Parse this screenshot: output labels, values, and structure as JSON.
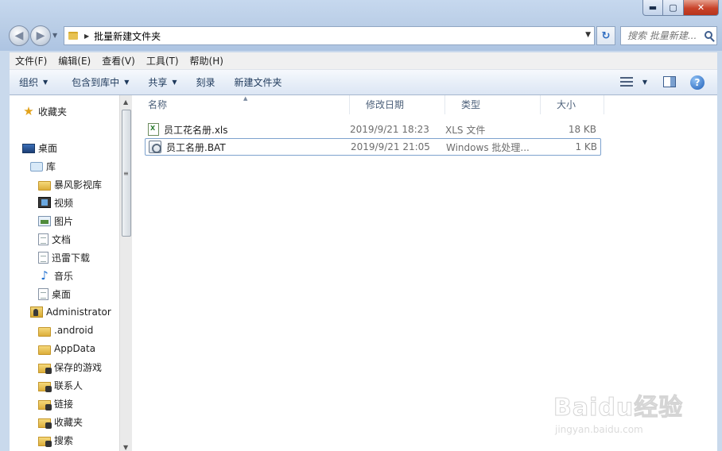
{
  "window": {
    "minimize_glyph": "▬",
    "maximize_glyph": "▢",
    "close_glyph": "✕"
  },
  "address_bar": {
    "path": "批量新建文件夹"
  },
  "search": {
    "placeholder": "搜索 批量新建..."
  },
  "menu": {
    "items": [
      "文件(F)",
      "编辑(E)",
      "查看(V)",
      "工具(T)",
      "帮助(H)"
    ]
  },
  "toolbar": {
    "organize": "组织",
    "include_in_library": "包含到库中",
    "share": "共享",
    "burn": "刻录",
    "new_folder": "新建文件夹"
  },
  "nav_pane": {
    "items": [
      {
        "label": "收藏夹",
        "icon": "star-icon"
      },
      {
        "label": "桌面",
        "icon": "desktop-icon"
      },
      {
        "label": "库",
        "icon": "library-icon"
      },
      {
        "label": "暴风影视库",
        "icon": "folder-icon"
      },
      {
        "label": "视频",
        "icon": "video-icon"
      },
      {
        "label": "图片",
        "icon": "picture-icon"
      },
      {
        "label": "文档",
        "icon": "document-icon"
      },
      {
        "label": "迅雷下载",
        "icon": "document-icon"
      },
      {
        "label": "音乐",
        "icon": "music-icon"
      },
      {
        "label": "桌面",
        "icon": "document-icon"
      },
      {
        "label": "Administrator",
        "icon": "user-folder-icon"
      },
      {
        "label": ".android",
        "icon": "folder-icon"
      },
      {
        "label": "AppData",
        "icon": "folder-icon"
      },
      {
        "label": "保存的游戏",
        "icon": "special-folder-icon"
      },
      {
        "label": "联系人",
        "icon": "special-folder-icon"
      },
      {
        "label": "链接",
        "icon": "special-folder-icon"
      },
      {
        "label": "收藏夹",
        "icon": "special-folder-icon"
      },
      {
        "label": "搜索",
        "icon": "special-folder-icon"
      }
    ]
  },
  "columns": {
    "name": "名称",
    "date": "修改日期",
    "type": "类型",
    "size": "大小"
  },
  "files": [
    {
      "name": "员工花名册.xls",
      "date": "2019/9/21 18:23",
      "type": "XLS 文件",
      "size": "18 KB",
      "icon": "xls-file-icon"
    },
    {
      "name": "员工名册.BAT",
      "date": "2019/9/21 21:05",
      "type": "Windows 批处理...",
      "size": "1 KB",
      "icon": "bat-file-icon"
    }
  ],
  "watermark": {
    "brand": "Baidu经验",
    "url": "jingyan.baidu.com"
  }
}
